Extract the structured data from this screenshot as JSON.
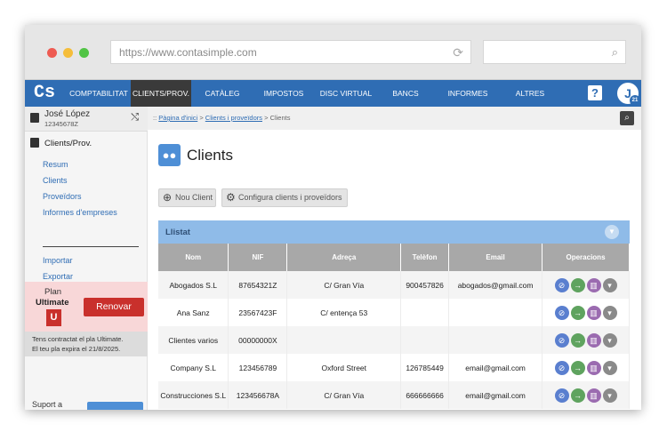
{
  "browser": {
    "url": "https://www.contasimple.com",
    "colors": {
      "close": "#ee5b52",
      "minimize": "#f5bd3a",
      "maximize": "#51c445"
    }
  },
  "nav": {
    "logo": "Cs",
    "items": [
      {
        "label": "COMPTABILITAT",
        "active": false
      },
      {
        "label": "CLIENTS/PROV.",
        "active": true
      },
      {
        "label": "CATÀLEG",
        "active": false
      },
      {
        "label": "IMPOSTOS",
        "active": false
      },
      {
        "label": "DISC VIRTUAL",
        "active": false
      },
      {
        "label": "BANCS",
        "active": false
      },
      {
        "label": "INFORMES",
        "active": false
      },
      {
        "label": "ALTRES",
        "active": false
      }
    ],
    "help": "?",
    "avatar_initial": "J",
    "avatar_badge": "21",
    "accent": "#2f6db4"
  },
  "sidebar": {
    "user_name": "José López",
    "user_nif": "12345678Z",
    "section_title": "Clients/Prov.",
    "links": [
      "Resum",
      "Clients",
      "Proveïdors",
      "Informes d'empreses"
    ],
    "links2": [
      "Importar",
      "Exportar"
    ],
    "plan_label": "Plan",
    "plan_name": "Ultimate",
    "plan_icon": "U",
    "renew_label": "Renovar",
    "plan_info_1": "Tens contractat el pla Ultimate.",
    "plan_info_2": "El teu pla expira el 21/8/2025.",
    "support_label": "Suport a"
  },
  "breadcrumb": {
    "prefix": "::",
    "home": "Pàgina d'inici",
    "mid": "Clients i proveïdors",
    "current": "Clients"
  },
  "main": {
    "title": "Clients",
    "new_client": "Nou Client",
    "configure": "Configura clients i proveïdors",
    "list_title": "Llistat"
  },
  "table": {
    "headers": [
      "Nom",
      "NIF",
      "Adreça",
      "Telèfon",
      "Email",
      "Operacions"
    ],
    "rows": [
      {
        "nom": "Abogados S.L",
        "nif": "87654321Z",
        "adreca": "C/ Gran Vía",
        "telefon": "900457826",
        "email": "abogados@gmail.com"
      },
      {
        "nom": "Ana Sanz",
        "nif": "23567423F",
        "adreca": "C/ entença 53",
        "telefon": "",
        "email": ""
      },
      {
        "nom": "Clientes varios",
        "nif": "00000000X",
        "adreca": "",
        "telefon": "",
        "email": ""
      },
      {
        "nom": "Company S.L",
        "nif": "123456789",
        "adreca": "Oxford Street",
        "telefon": "126785449",
        "email": "email@gmail.com"
      },
      {
        "nom": "Construcciones S.L",
        "nif": "123456678A",
        "adreca": "C/ Gran Vía",
        "telefon": "666666666",
        "email": "email@gmail.com"
      }
    ],
    "op_icons": [
      "paperclip-icon",
      "arrow-right-icon",
      "bank-icon",
      "chevron-down-icon"
    ],
    "op_colors": [
      "#5a7fcf",
      "#5fa35f",
      "#9b6bb0",
      "#8a8a8a"
    ]
  }
}
